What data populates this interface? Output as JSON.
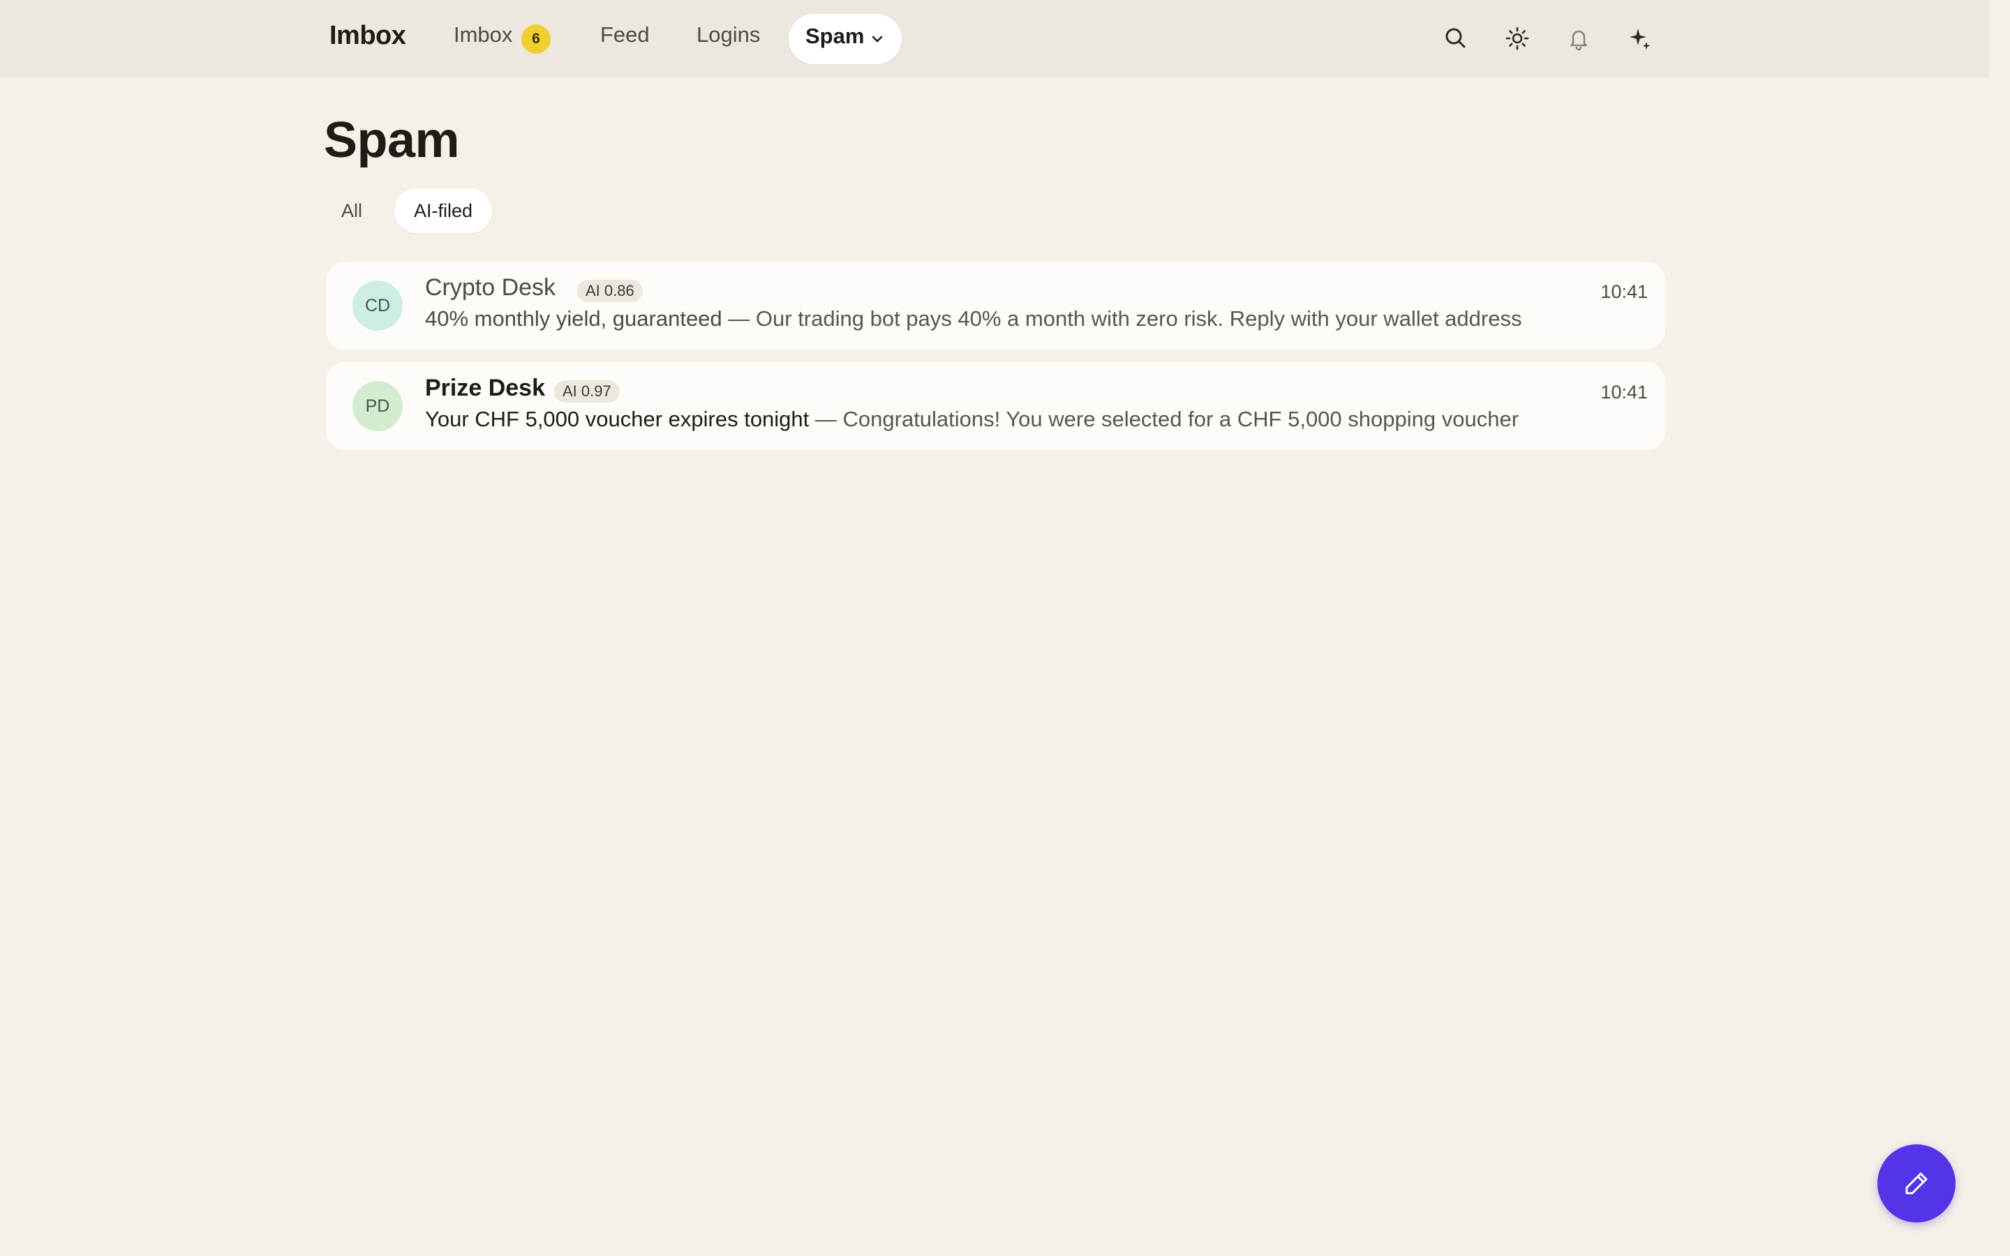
{
  "app": {
    "brand": "Imbox"
  },
  "nav": {
    "imbox": "Imbox",
    "imbox_count": "6",
    "feed": "Feed",
    "logins": "Logins",
    "spam": "Spam"
  },
  "toolbar": {
    "icons": [
      "search-icon",
      "sun-icon",
      "bell-icon",
      "sparkle-icon"
    ]
  },
  "page": {
    "title": "Spam",
    "filters": [
      "All",
      "AI-filed"
    ],
    "active_filter": "AI-filed"
  },
  "messages": [
    {
      "initials": "CD",
      "sender": "Crypto Desk",
      "ai_tag": "AI 0.86",
      "subject": "40% monthly yield, guaranteed",
      "preview": "— Our trading bot pays 40% a month with zero risk. Reply with your wallet address",
      "time": "10:41",
      "unread": false
    },
    {
      "initials": "PD",
      "sender": "Prize Desk",
      "ai_tag": "AI 0.97",
      "subject": "Your CHF 5,000 voucher expires tonight",
      "preview": "— Congratulations! You were selected for a CHF 5,000 shopping voucher",
      "time": "10:41",
      "unread": true
    }
  ],
  "colors": {
    "background": "#f5f1e8",
    "topbar": "#ece8df",
    "badge": "#f2cf2e",
    "fab": "#5533e8"
  },
  "fab": {
    "icon": "pencil-icon"
  }
}
